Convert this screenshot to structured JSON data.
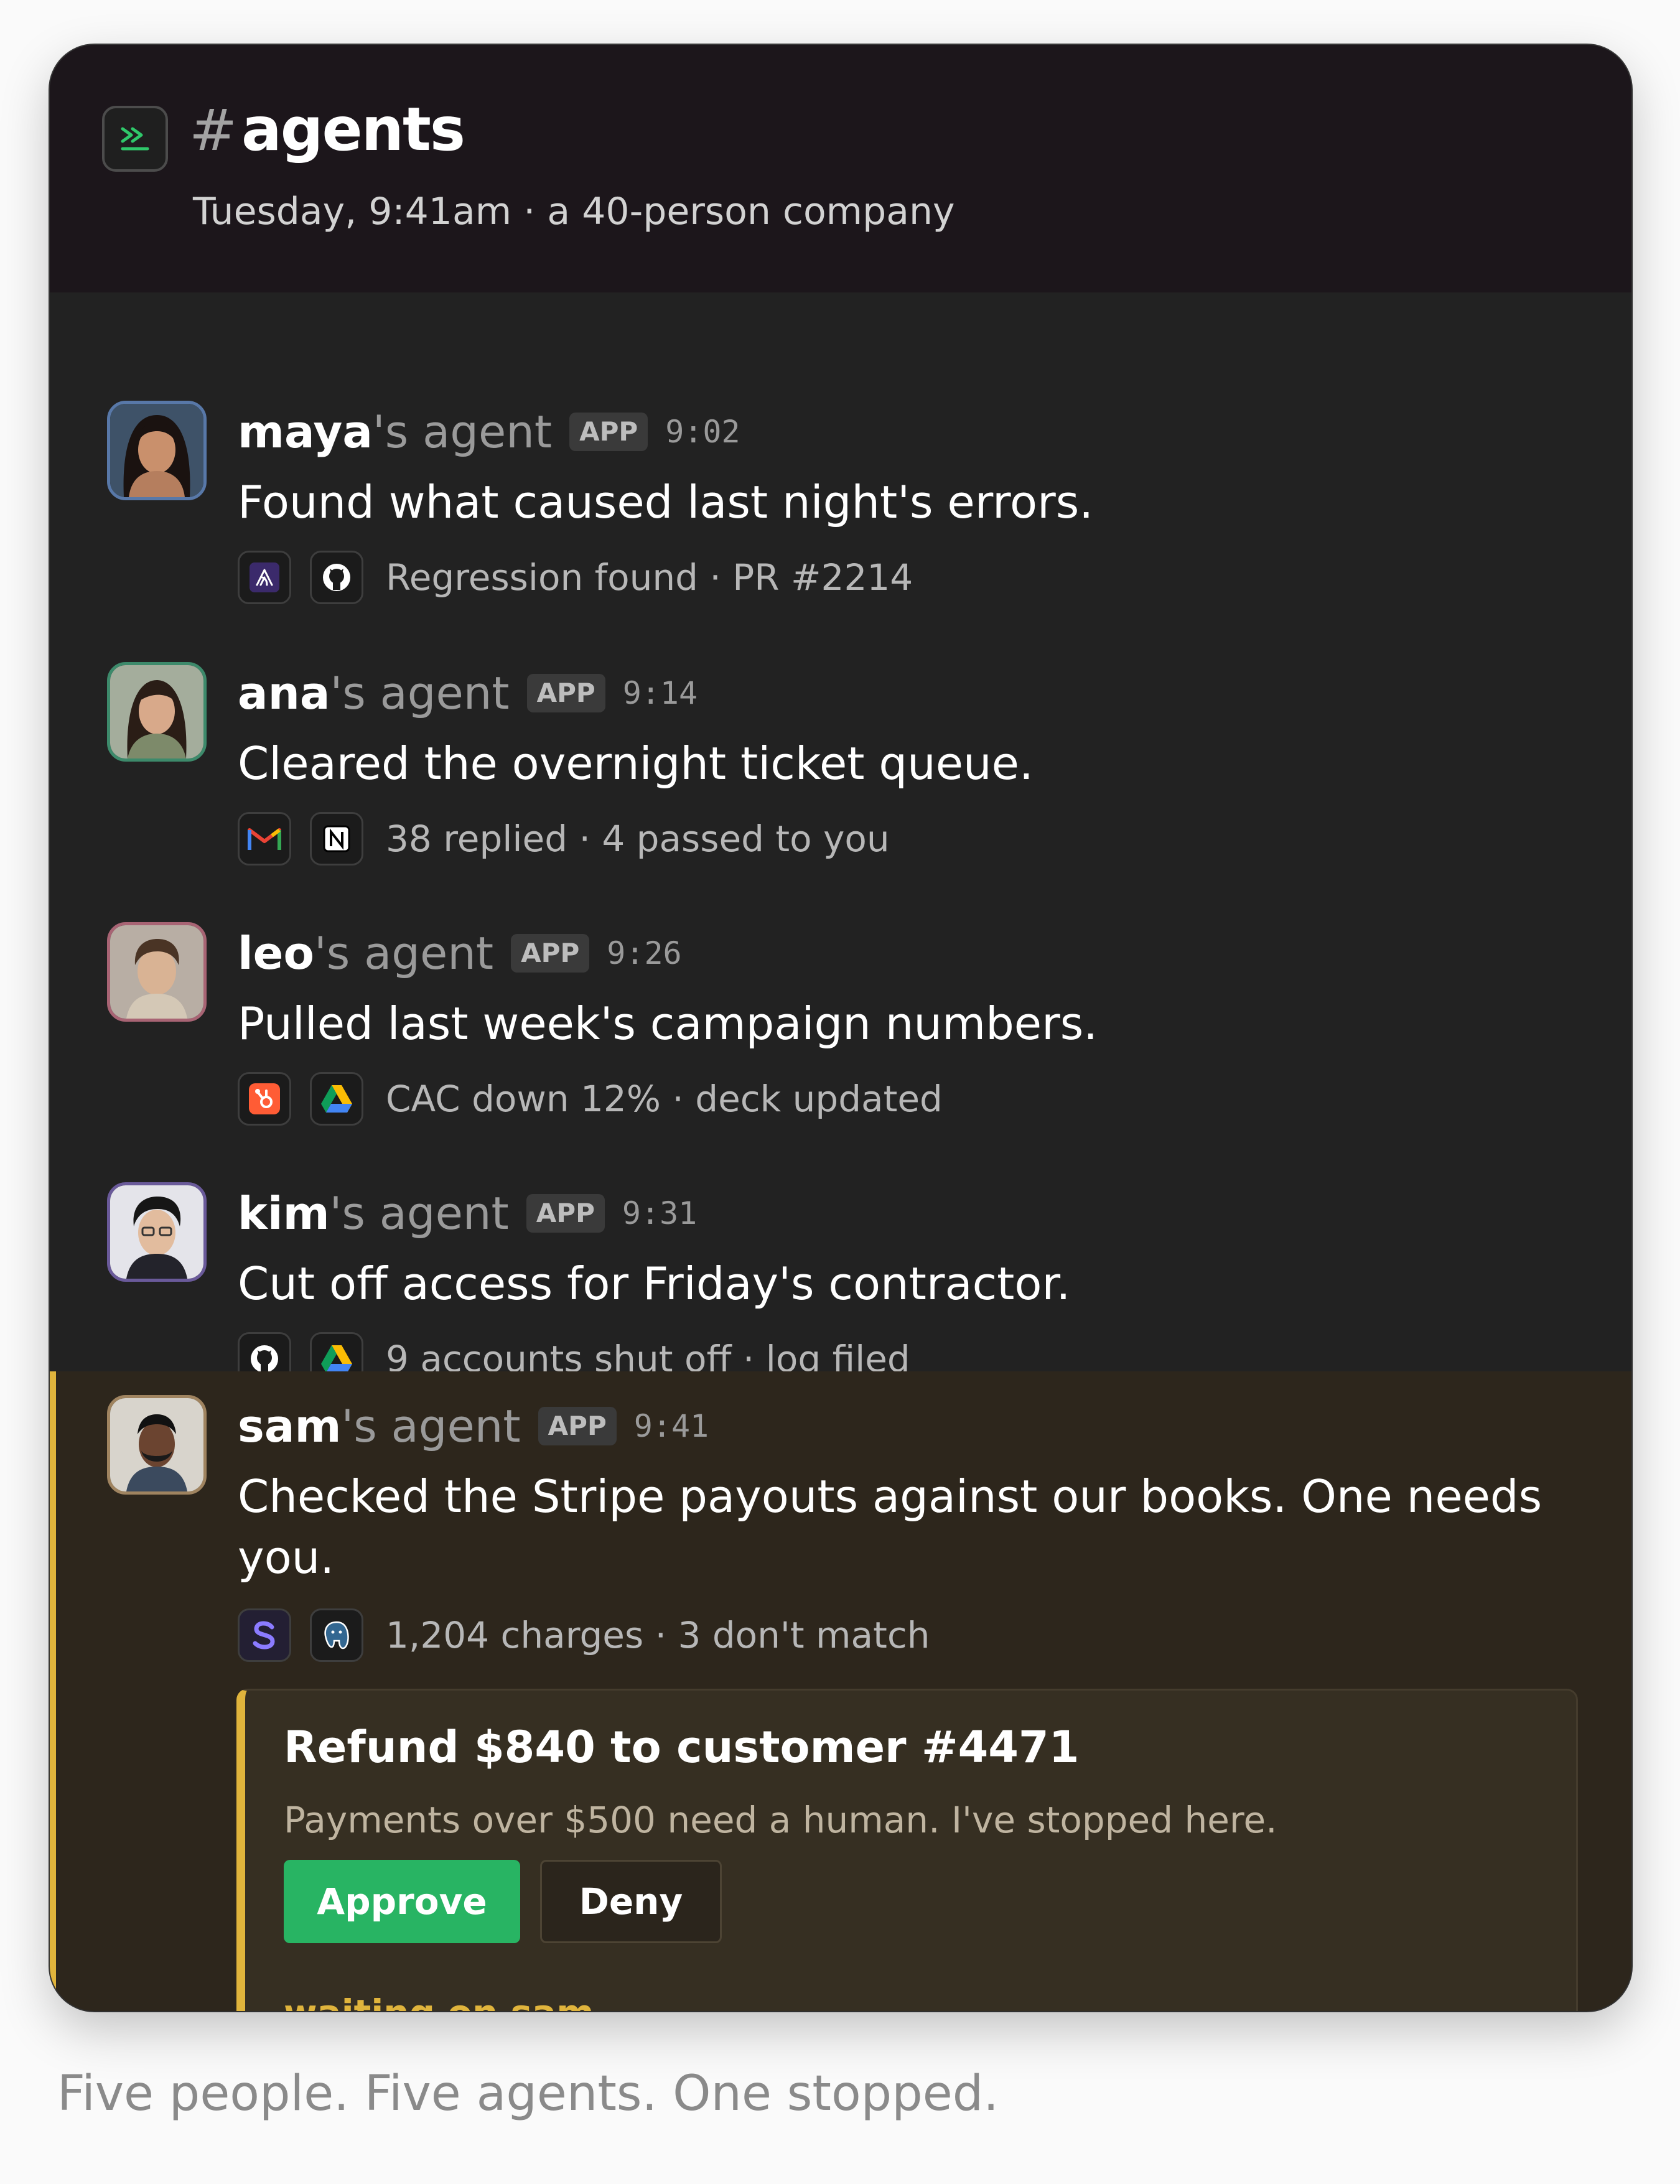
{
  "channel": {
    "hash": "#",
    "name": "agents",
    "subtitle": "Tuesday, 9:41am · a 40-person company",
    "icon": "terminal-chevrons-icon"
  },
  "messages": [
    {
      "user": "maya",
      "suffix": "'s agent",
      "badge": "APP",
      "time": "9:02",
      "text": "Found what caused last night's errors.",
      "tools": [
        "sentry-icon",
        "github-icon"
      ],
      "meta": "Regression found · PR #2214",
      "avatar_border": "#5878a8"
    },
    {
      "user": "ana",
      "suffix": "'s agent",
      "badge": "APP",
      "time": "9:14",
      "text": "Cleared the overnight ticket queue.",
      "tools": [
        "gmail-icon",
        "notion-icon"
      ],
      "meta": "38 replied · 4 passed to you",
      "avatar_border": "#3d8a6b"
    },
    {
      "user": "leo",
      "suffix": "'s agent",
      "badge": "APP",
      "time": "9:26",
      "text": "Pulled last week's campaign numbers.",
      "tools": [
        "hubspot-icon",
        "google-drive-icon"
      ],
      "meta": "CAC down 12% · deck updated",
      "avatar_border": "#a86474"
    },
    {
      "user": "kim",
      "suffix": "'s agent",
      "badge": "APP",
      "time": "9:31",
      "text": "Cut off access for Friday's contractor.",
      "tools": [
        "github-icon",
        "google-drive-icon"
      ],
      "meta": "9 accounts shut off · log filed",
      "avatar_border": "#6a5a9a"
    },
    {
      "user": "sam",
      "suffix": "'s agent",
      "badge": "APP",
      "time": "9:41",
      "text_line1": "Checked the Stripe payouts against our books. One needs",
      "text_line2": "you.",
      "tools": [
        "stripe-icon",
        "postgres-icon"
      ],
      "meta": "1,204 charges · 3 don't match",
      "avatar_border": "#a08460"
    }
  ],
  "approval": {
    "title": "Refund $840 to customer #4471",
    "body": "Payments over $500 need a human. I've stopped here.",
    "approve_label": "Approve",
    "deny_label": "Deny",
    "status": "waiting on sam"
  },
  "caption": "Five people. Five agents. One stopped.",
  "colors": {
    "header_bg": "#1c161b",
    "feed_bg": "#222222",
    "highlight_bg": "#2d261c",
    "accent_yellow": "#e0b43c",
    "approve_green": "#28b463"
  }
}
